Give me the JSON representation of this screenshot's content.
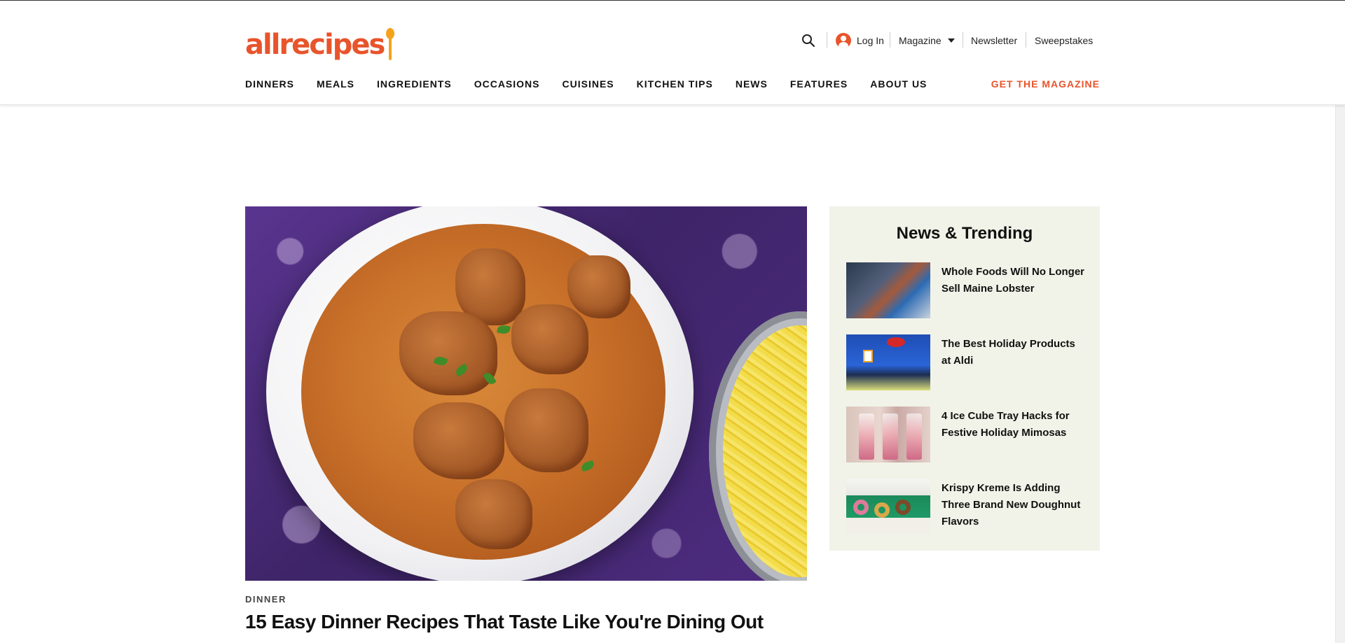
{
  "brand": {
    "logo_text": "allrecipes",
    "accent_color": "#e8542b",
    "spoon_color": "#f4a21c"
  },
  "header": {
    "utility": {
      "search_icon": "search-icon",
      "login_label": "Log In",
      "account_icon": "account-icon",
      "magazine_label": "Magazine",
      "newsletter_label": "Newsletter",
      "sweepstakes_label": "Sweepstakes"
    },
    "nav": [
      {
        "label": "DINNERS"
      },
      {
        "label": "MEALS"
      },
      {
        "label": "INGREDIENTS"
      },
      {
        "label": "OCCASIONS"
      },
      {
        "label": "CUISINES"
      },
      {
        "label": "KITCHEN TIPS"
      },
      {
        "label": "NEWS"
      },
      {
        "label": "FEATURES"
      },
      {
        "label": "ABOUT US"
      }
    ],
    "get_magazine_label": "GET THE MAGAZINE"
  },
  "hero": {
    "eyebrow": "DINNER",
    "title": "15 Easy Dinner Recipes That Taste Like You're Dining Out"
  },
  "trending": {
    "title": "News & Trending",
    "background_color": "#f1f3e8",
    "items": [
      {
        "title": "Whole Foods Will No Longer Sell Maine Lobster"
      },
      {
        "title": "The Best Holiday Products at Aldi"
      },
      {
        "title": "4 Ice Cube Tray Hacks for Festive Holiday Mimosas"
      },
      {
        "title": "Krispy Kreme Is Adding Three Brand New Doughnut Flavors"
      }
    ]
  }
}
